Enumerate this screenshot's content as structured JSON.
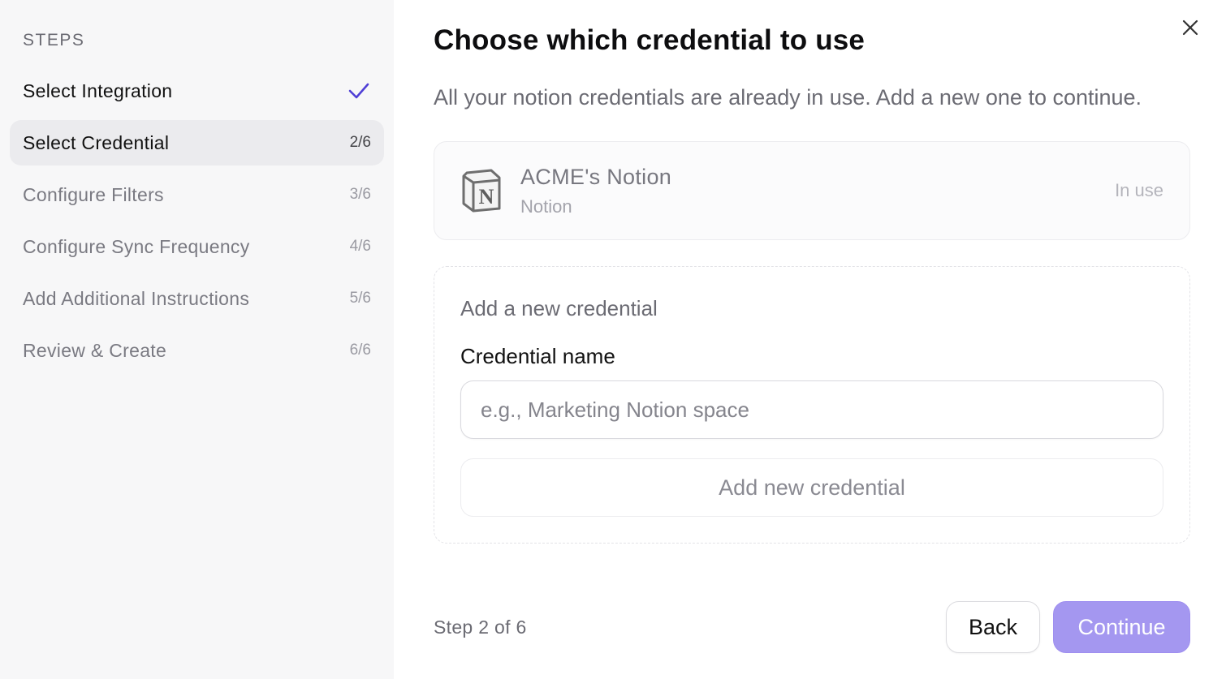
{
  "sidebar": {
    "title": "STEPS",
    "steps": [
      {
        "label": "Select Integration",
        "count": "",
        "state": "done"
      },
      {
        "label": "Select Credential",
        "count": "2/6",
        "state": "active"
      },
      {
        "label": "Configure Filters",
        "count": "3/6",
        "state": "pending"
      },
      {
        "label": "Configure Sync Frequency",
        "count": "4/6",
        "state": "pending"
      },
      {
        "label": "Add Additional Instructions",
        "count": "5/6",
        "state": "pending"
      },
      {
        "label": "Review & Create",
        "count": "6/6",
        "state": "pending"
      }
    ]
  },
  "main": {
    "title": "Choose which credential to use",
    "subtitle": "All your notion credentials are already in use. Add a new one to continue.",
    "existing_credential": {
      "name": "ACME's Notion",
      "type": "Notion",
      "status": "In use",
      "icon": "notion-icon"
    },
    "new_credential": {
      "title": "Add a new credential",
      "field_label": "Credential name",
      "placeholder": "e.g., Marketing Notion space",
      "value": "",
      "add_button": "Add new credential"
    }
  },
  "footer": {
    "step_text": "Step 2 of 6",
    "back_label": "Back",
    "continue_label": "Continue"
  },
  "colors": {
    "accent": "#a497f0",
    "check": "#4f3fd6",
    "sidebar_bg": "#f7f7f8"
  }
}
